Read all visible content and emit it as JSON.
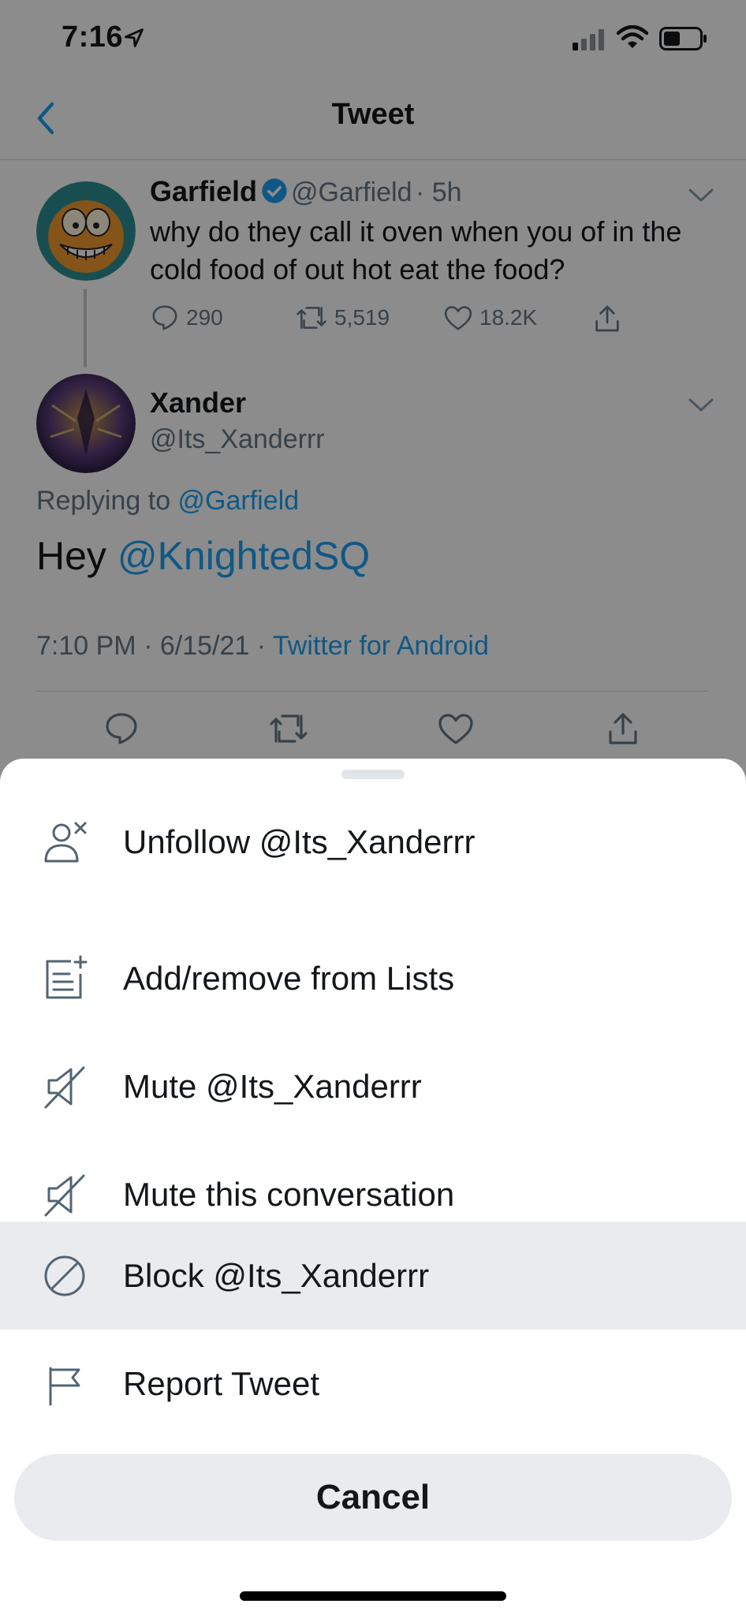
{
  "status_bar": {
    "time": "7:16"
  },
  "nav": {
    "title": "Tweet"
  },
  "parent_tweet": {
    "name": "Garfield",
    "handle": "@Garfield",
    "time": "· 5h",
    "text_line1": "why do they call it oven when you of in the",
    "text_line2": "cold food of out hot eat the food?",
    "replies": "290",
    "retweets": "5,519",
    "likes": "18.2K"
  },
  "reply_tweet": {
    "name": "Xander",
    "handle": "@Its_Xanderrr",
    "replying_prefix": "Replying to ",
    "replying_to": "@Garfield",
    "text_prefix": "Hey ",
    "text_mention": "@KnightedSQ",
    "timestamp": "7:10 PM · 6/15/21 · ",
    "source": "Twitter for Android"
  },
  "sheet": {
    "items": [
      {
        "label": "Unfollow @Its_Xanderrr",
        "icon": "unfollow-icon"
      },
      {
        "label": "Add/remove from Lists",
        "icon": "lists-add-icon"
      },
      {
        "label": "Mute @Its_Xanderrr",
        "icon": "mute-icon"
      },
      {
        "label": "Mute this conversation",
        "icon": "mute-icon"
      },
      {
        "label": "Block @Its_Xanderrr",
        "icon": "block-icon"
      },
      {
        "label": "Report Tweet",
        "icon": "flag-icon"
      }
    ],
    "cancel_label": "Cancel"
  },
  "colors": {
    "accent": "#1da1f2",
    "highlight": "#e9ebee",
    "overlay": "rgba(0,0,0,0.45)"
  }
}
